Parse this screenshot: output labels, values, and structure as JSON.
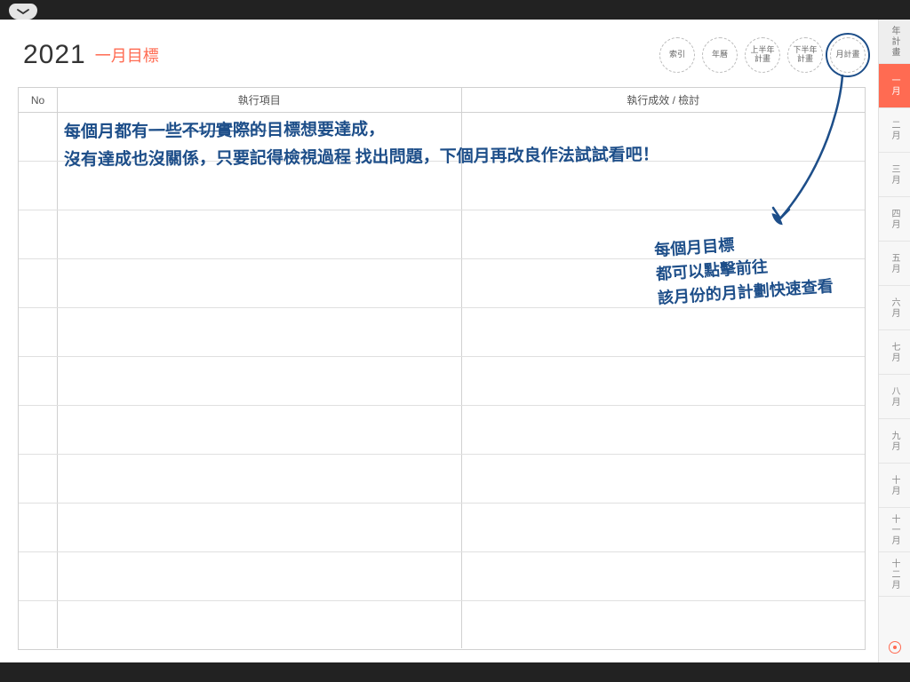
{
  "header": {
    "year": "2021",
    "subtitle": "一月目標"
  },
  "nav_pills": [
    {
      "label": "索引"
    },
    {
      "label": "年曆"
    },
    {
      "line1": "上半年",
      "line2": "計畫"
    },
    {
      "line1": "下半年",
      "line2": "計畫"
    },
    {
      "label": "月計畫",
      "circled": true
    }
  ],
  "table": {
    "col_no": "No",
    "col_item": "執行項目",
    "col_result": "執行成效 / 檢討",
    "row_count": 11
  },
  "right_rail": {
    "head": "年計畫",
    "months": [
      "一月",
      "二月",
      "三月",
      "四月",
      "五月",
      "六月",
      "七月",
      "八月",
      "九月",
      "十月",
      "十一月",
      "十二月"
    ],
    "active_index": 0
  },
  "handwriting": {
    "line1_a": "每個月都有一些",
    "line1_strike": "不切實際的",
    "line1_b": "目標想要達成，",
    "line2": "沒有達成也沒關係，只要記得檢視過程 找出問題，下個月再改良作法試試看吧！",
    "note_l1": "每個月目標",
    "note_l2": "都可以點擊前往",
    "note_l3": "該月份的月計劃快速查看"
  },
  "colors": {
    "accent": "#ff6b52",
    "ink": "#1d4e89"
  }
}
